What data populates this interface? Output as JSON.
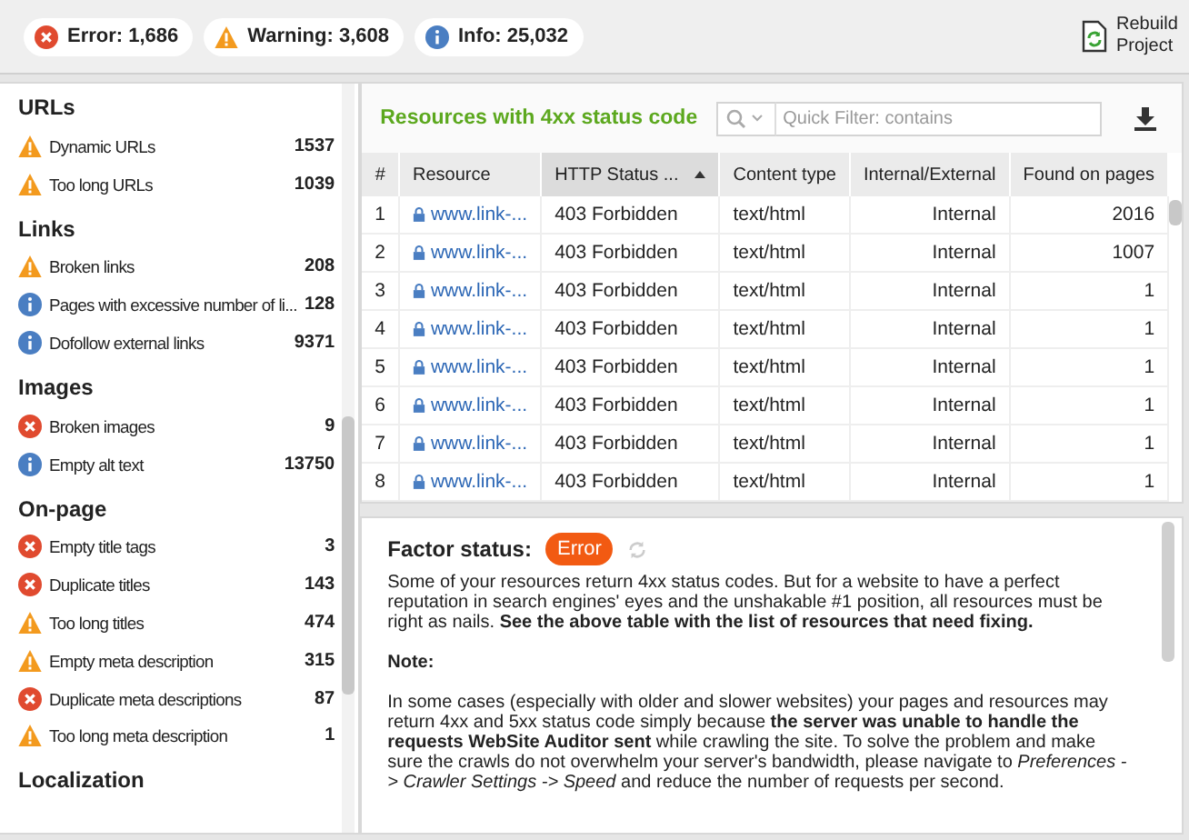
{
  "summary": [
    {
      "kind": "error",
      "label": "Error: 1,686"
    },
    {
      "kind": "warning",
      "label": "Warning: 3,608"
    },
    {
      "kind": "info",
      "label": "Info: 25,032"
    }
  ],
  "rebuild_button": "Rebuild Project",
  "sidebar": {
    "sections": [
      {
        "title": "URLs",
        "items": [
          {
            "kind": "warning",
            "label": "Dynamic URLs",
            "count": "1537"
          },
          {
            "kind": "warning",
            "label": "Too long URLs",
            "count": "1039"
          }
        ]
      },
      {
        "title": "Links",
        "items": [
          {
            "kind": "warning",
            "label": "Broken links",
            "count": "208"
          },
          {
            "kind": "info",
            "label": "Pages with excessive number of li...",
            "count": "128"
          },
          {
            "kind": "info",
            "label": "Dofollow external links",
            "count": "9371"
          }
        ]
      },
      {
        "title": "Images",
        "items": [
          {
            "kind": "error",
            "label": "Broken images",
            "count": "9"
          },
          {
            "kind": "info",
            "label": "Empty alt text",
            "count": "13750"
          }
        ]
      },
      {
        "title": "On-page",
        "items": [
          {
            "kind": "error",
            "label": "Empty title tags",
            "count": "3"
          },
          {
            "kind": "error",
            "label": "Duplicate titles",
            "count": "143"
          },
          {
            "kind": "warning",
            "label": "Too long titles",
            "count": "474"
          },
          {
            "kind": "warning",
            "label": "Empty meta description",
            "count": "315"
          },
          {
            "kind": "error",
            "label": "Duplicate meta descriptions",
            "count": "87"
          },
          {
            "kind": "warning",
            "label": "Too long meta description",
            "count": "1"
          }
        ]
      },
      {
        "title": "Localization"
      }
    ]
  },
  "table_panel": {
    "title": "Resources with 4xx status code",
    "filter": {
      "placeholder": "Quick Filter: contains"
    },
    "columns": [
      {
        "label": "#",
        "sorted": false
      },
      {
        "label": "Resource",
        "sorted": false
      },
      {
        "label": "HTTP Status ...",
        "sorted": true
      },
      {
        "label": "Content type",
        "sorted": false
      },
      {
        "label": "Internal/External",
        "sorted": false
      },
      {
        "label": "Found on pages",
        "sorted": false
      }
    ],
    "rows": [
      [
        "1",
        "www.link-...",
        "403 Forbidden",
        "text/html",
        "Internal",
        "2016"
      ],
      [
        "2",
        "www.link-...",
        "403 Forbidden",
        "text/html",
        "Internal",
        "1007"
      ],
      [
        "3",
        "www.link-...",
        "403 Forbidden",
        "text/html",
        "Internal",
        "1"
      ],
      [
        "4",
        "www.link-...",
        "403 Forbidden",
        "text/html",
        "Internal",
        "1"
      ],
      [
        "5",
        "www.link-...",
        "403 Forbidden",
        "text/html",
        "Internal",
        "1"
      ],
      [
        "6",
        "www.link-...",
        "403 Forbidden",
        "text/html",
        "Internal",
        "1"
      ],
      [
        "7",
        "www.link-...",
        "403 Forbidden",
        "text/html",
        "Internal",
        "1"
      ],
      [
        "8",
        "www.link-...",
        "403 Forbidden",
        "text/html",
        "Internal",
        "1"
      ]
    ]
  },
  "factor": {
    "label": "Factor status:",
    "status": {
      "kind": "error",
      "text": "Error"
    },
    "paragraphs": [
      "Some of your resources return 4xx status codes. But for a website to have a perfect reputation in search engines' eyes and the unshakable #1 position, all resources must be right as nails. **See the above table with the list of resources that need fixing.**",
      "**Note:**",
      "In some cases (especially with older and slower websites) your pages and resources may return 4xx and 5xx status code simply because **the server was unable to handle the requests WebSite Auditor sent** while crawling the site. To solve the problem and make sure the crawls do not overwhelm your server's bandwidth, please navigate to *Preferences -> Crawler Settings -> Speed* and reduce the number of requests per second."
    ]
  }
}
